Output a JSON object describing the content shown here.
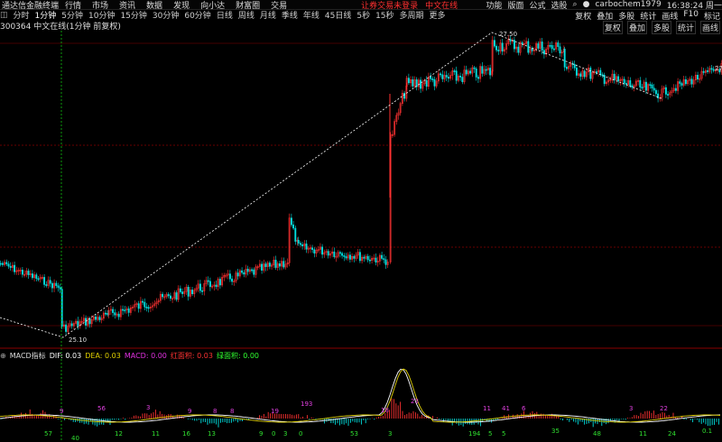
{
  "menubar": {
    "app_name": "通达信金融终端",
    "items": [
      "行情",
      "市场",
      "资讯",
      "数据",
      "发现",
      "向小达",
      "财富圈",
      "交易"
    ],
    "promo": "让券交易未登录",
    "promo2": "中文在线",
    "right_items": [
      "功能",
      "版面",
      "公式",
      "选股"
    ],
    "user": "carbochem1979",
    "clock": "16:38:24 周一"
  },
  "toolbar": {
    "items": [
      "分时",
      "1分钟",
      "5分钟",
      "10分钟",
      "15分钟",
      "30分钟",
      "60分钟",
      "日线",
      "周线",
      "月线",
      "季线",
      "年线",
      "45日线",
      "5秒",
      "15秒",
      "多周期",
      "更多"
    ],
    "active_index": 1,
    "right_buttons": [
      "复权",
      "叠加",
      "多股",
      "统计",
      "画线",
      "F10",
      "标记"
    ]
  },
  "infobar": {
    "code_title": "300364 中文在线(1分钟 前复权)",
    "right_buttons": [
      "复权",
      "叠加",
      "多股",
      "统计",
      "画线"
    ],
    "price_label_right": "27"
  },
  "main_chart": {
    "high_label": "27.50",
    "low_label": "25.10",
    "colors": {
      "up": "#ff3232",
      "down": "#00e0e0",
      "dash": "#ffffff",
      "grid": "#8a0000",
      "vline": "#10c010",
      "yellow": "#e0d000"
    }
  },
  "macd": {
    "label": "MACD指标",
    "dif_label": "DIF: 0.03",
    "dea_label": "DEA: 0.03",
    "macd_label": "MACD: 0.00",
    "red_area": "红面积: 0.03",
    "green_area": "绿面积: 0.00",
    "numbers_purple": [
      {
        "t": "9"
      },
      {
        "t": "56"
      },
      {
        "t": "3"
      },
      {
        "t": "9"
      },
      {
        "t": "8"
      },
      {
        "t": "8"
      },
      {
        "t": "19"
      },
      {
        "t": "193"
      },
      {
        "t": "18"
      },
      {
        "t": "23"
      },
      {
        "t": "11"
      },
      {
        "t": "41"
      },
      {
        "t": "6"
      },
      {
        "t": "3"
      },
      {
        "t": "22"
      }
    ],
    "numbers_green": [
      {
        "t": "57"
      },
      {
        "t": "40"
      },
      {
        "t": "12"
      },
      {
        "t": "11"
      },
      {
        "t": "16"
      },
      {
        "t": "13"
      },
      {
        "t": "9"
      },
      {
        "t": "0"
      },
      {
        "t": "3"
      },
      {
        "t": "0"
      },
      {
        "t": "53"
      },
      {
        "t": "3"
      },
      {
        "t": "194"
      },
      {
        "t": "5"
      },
      {
        "t": "5"
      },
      {
        "t": "35"
      },
      {
        "t": "48"
      },
      {
        "t": "11"
      },
      {
        "t": "24"
      },
      {
        "t": "0.1"
      }
    ]
  }
}
